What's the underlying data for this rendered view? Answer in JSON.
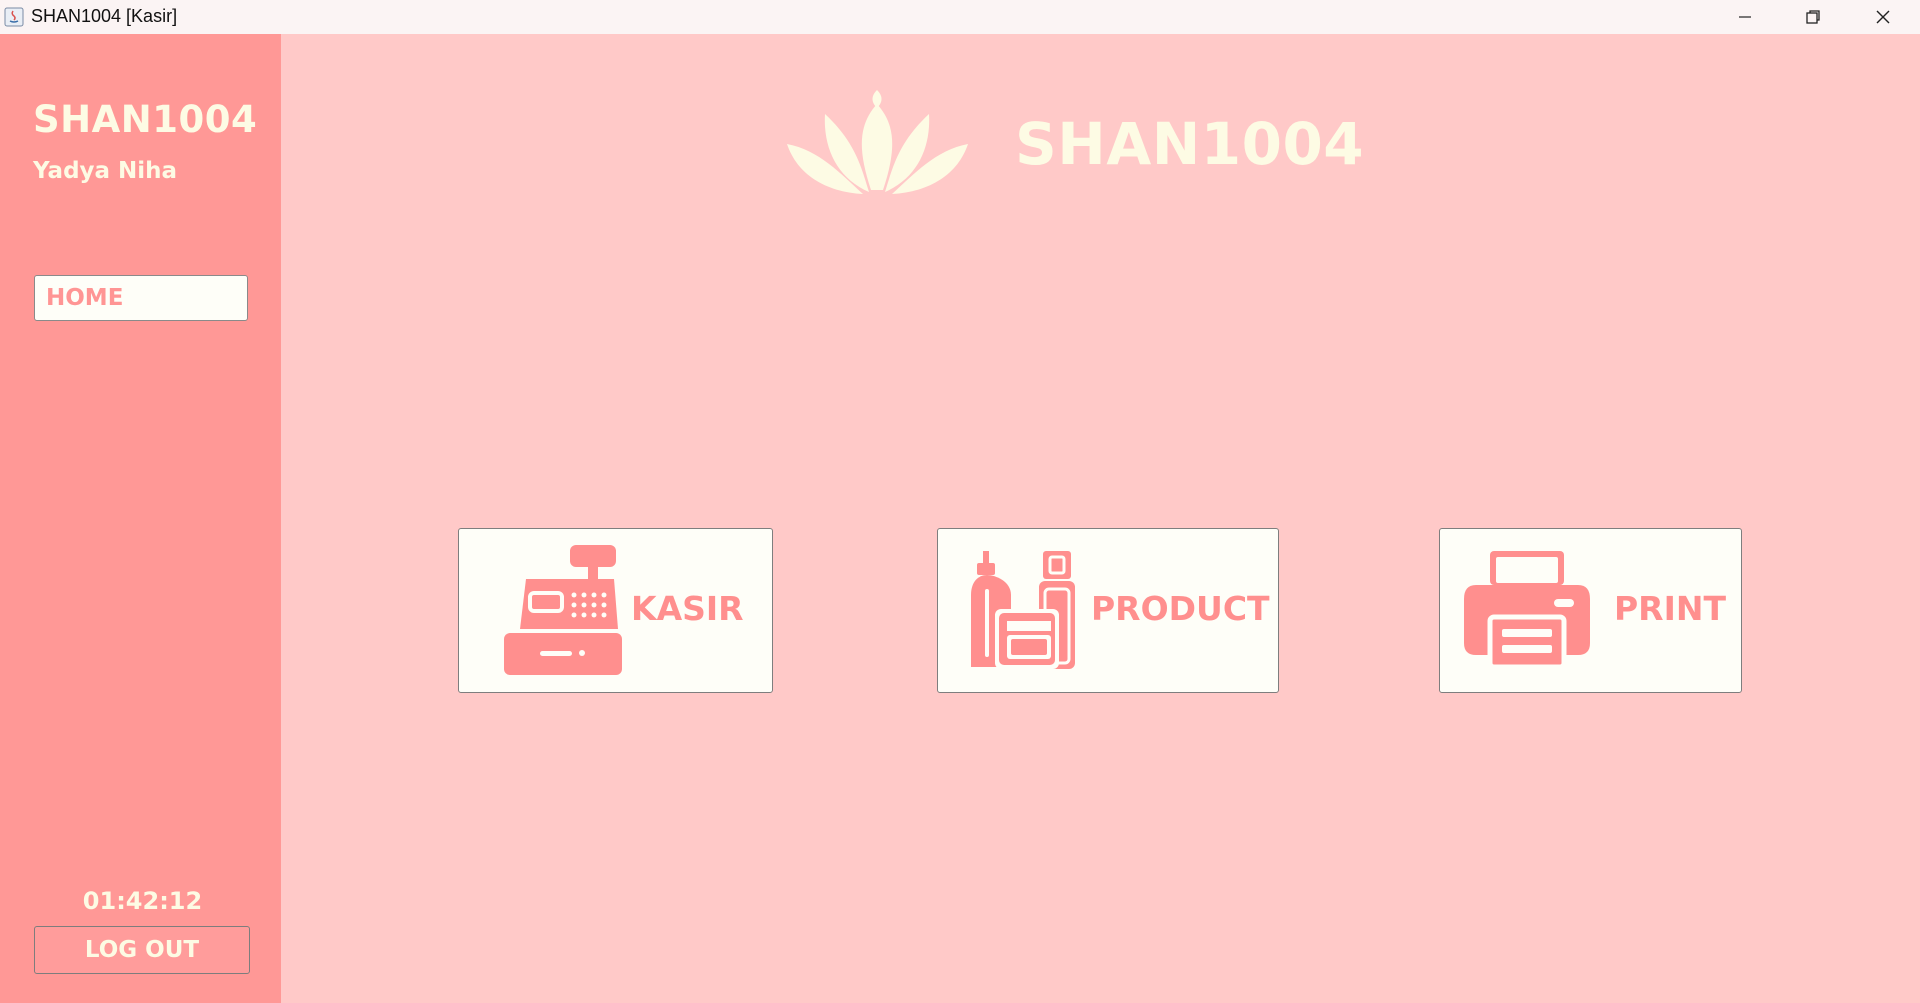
{
  "window": {
    "title": "SHAN1004 [Kasir]"
  },
  "sidebar": {
    "brand": "SHAN1004",
    "user": "Yadya Niha",
    "home_label": "HOME",
    "clock": "01:42:12",
    "logout_label": "LOG OUT"
  },
  "header": {
    "title": "SHAN1004",
    "logo_icon": "lotus-icon"
  },
  "menu": {
    "kasir": {
      "label": "KASIR",
      "icon": "cash-register-icon"
    },
    "product": {
      "label": "PRODUCT",
      "icon": "cosmetics-icon"
    },
    "print": {
      "label": "PRINT",
      "icon": "printer-icon"
    }
  },
  "colors": {
    "background": "#ffc9c8",
    "sidebar": "#ff9896",
    "accent": "#ff8f8e",
    "cream": "#fdfbe4"
  }
}
